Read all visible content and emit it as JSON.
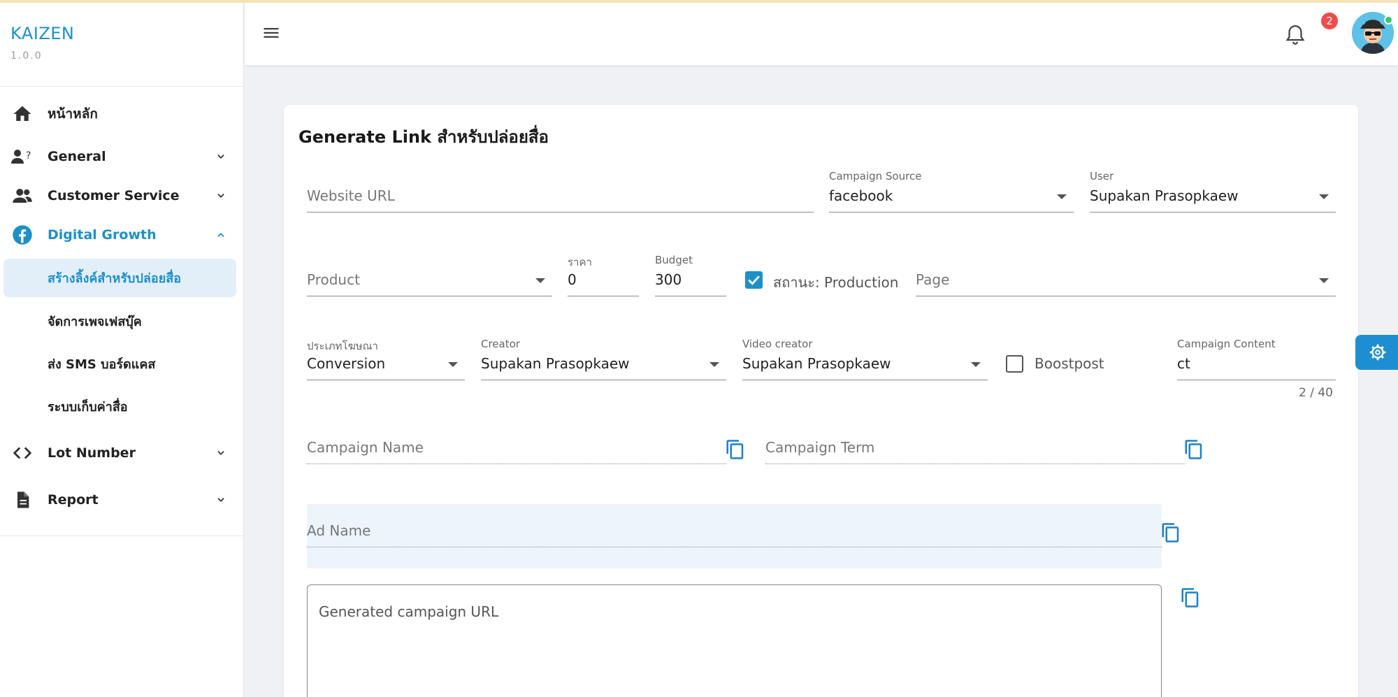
{
  "brand": {
    "name": "KAIZEN",
    "version": "1.0.0"
  },
  "sidebar": {
    "items": [
      {
        "label": "หน้าหลัก",
        "icon": "home-icon"
      },
      {
        "label": "General",
        "icon": "person-question-icon"
      },
      {
        "label": "Customer Service",
        "icon": "people-icon"
      },
      {
        "label": "Digital Growth",
        "icon": "facebook-icon"
      },
      {
        "label": "Lot Number",
        "icon": "code-icon"
      },
      {
        "label": "Report",
        "icon": "document-icon"
      }
    ],
    "subitems": [
      {
        "label": "สร้างลิ้งค์สำหรับปล่อยสื่อ"
      },
      {
        "label": "จัดการเพจเฟสบุ๊ค"
      },
      {
        "label": "ส่ง SMS บอร์ดแคส"
      },
      {
        "label": "ระบบเก็บค่าสื่อ"
      }
    ]
  },
  "header": {
    "notification_count": "2"
  },
  "form": {
    "title": "Generate Link สำหรับปล่อยสื่อ",
    "website_url": {
      "placeholder": "Website URL"
    },
    "campaign_source": {
      "label": "Campaign Source",
      "value": "facebook"
    },
    "user": {
      "label": "User",
      "value": "Supakan Prasopkaew"
    },
    "product": {
      "placeholder": "Product"
    },
    "price": {
      "label": "ราคา",
      "value": "0"
    },
    "budget": {
      "label": "Budget",
      "value": "300"
    },
    "status": {
      "label": "สถานะ: Production",
      "checked": true
    },
    "page": {
      "placeholder": "Page"
    },
    "ad_type": {
      "label": "ประเภทโฆษณา",
      "value": "Conversion"
    },
    "creator": {
      "label": "Creator",
      "value": "Supakan Prasopkaew"
    },
    "video_creator": {
      "label": "Video creator",
      "value": "Supakan Prasopkaew"
    },
    "boostpost": {
      "label": "Boostpost",
      "checked": false
    },
    "campaign_content": {
      "label": "Campaign Content",
      "value": "ct",
      "counter": "2 / 40"
    },
    "campaign_name": {
      "placeholder": "Campaign Name"
    },
    "campaign_term": {
      "placeholder": "Campaign Term"
    },
    "ad_name": {
      "placeholder": "Ad Name"
    },
    "generated_url": {
      "placeholder": "Generated campaign URL"
    }
  },
  "colors": {
    "accent": "#1e90c8",
    "badge": "#f04b4b",
    "selected_bg": "#e3eff8"
  }
}
